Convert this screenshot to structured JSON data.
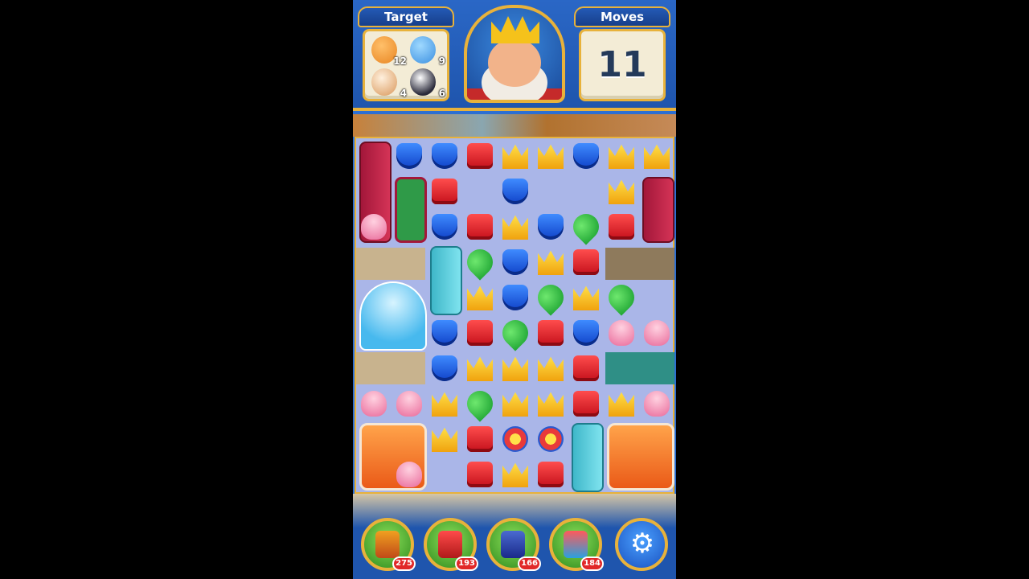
{
  "hud": {
    "target_title": "Target",
    "moves_title": "Moves",
    "moves_value": "11",
    "targets": [
      {
        "icon": "teddy-bear-icon",
        "count": "12"
      },
      {
        "icon": "blue-balloon-icon",
        "count": "9"
      },
      {
        "icon": "hamster-icon",
        "count": "4"
      },
      {
        "icon": "penguin-icon",
        "count": "6"
      }
    ]
  },
  "boosters": [
    {
      "icon": "hammer-icon",
      "count": "275"
    },
    {
      "icon": "arrow-icon",
      "count": "193"
    },
    {
      "icon": "cannon-icon",
      "count": "166"
    },
    {
      "icon": "jester-icon",
      "count": "184"
    }
  ],
  "settings_icon": "gear-icon",
  "settings_glyph": "⚙",
  "board": {
    "columns": 9,
    "rows": 10,
    "gems": [
      [
        1,
        0,
        "blue"
      ],
      [
        2,
        0,
        "blue"
      ],
      [
        3,
        0,
        "red"
      ],
      [
        4,
        0,
        "yellow"
      ],
      [
        5,
        0,
        "yellow"
      ],
      [
        6,
        0,
        "blue"
      ],
      [
        7,
        0,
        "yellow"
      ],
      [
        8,
        0,
        "yellow"
      ],
      [
        2,
        1,
        "red"
      ],
      [
        4,
        1,
        "blue"
      ],
      [
        7,
        1,
        "yellow"
      ],
      [
        0,
        2,
        "shell"
      ],
      [
        2,
        2,
        "blue"
      ],
      [
        3,
        2,
        "red"
      ],
      [
        4,
        2,
        "yellow"
      ],
      [
        5,
        2,
        "blue"
      ],
      [
        6,
        2,
        "green"
      ],
      [
        7,
        2,
        "red"
      ],
      [
        3,
        3,
        "green"
      ],
      [
        4,
        3,
        "blue"
      ],
      [
        5,
        3,
        "yellow"
      ],
      [
        6,
        3,
        "red"
      ],
      [
        3,
        4,
        "yellow"
      ],
      [
        4,
        4,
        "blue"
      ],
      [
        5,
        4,
        "green"
      ],
      [
        6,
        4,
        "yellow"
      ],
      [
        7,
        4,
        "green"
      ],
      [
        2,
        5,
        "blue"
      ],
      [
        3,
        5,
        "red"
      ],
      [
        4,
        5,
        "green"
      ],
      [
        5,
        5,
        "red"
      ],
      [
        6,
        5,
        "blue"
      ],
      [
        7,
        5,
        "shell"
      ],
      [
        8,
        5,
        "shell"
      ],
      [
        2,
        6,
        "blue"
      ],
      [
        3,
        6,
        "yellow"
      ],
      [
        4,
        6,
        "yellow"
      ],
      [
        5,
        6,
        "yellow"
      ],
      [
        6,
        6,
        "red"
      ],
      [
        0,
        7,
        "shell"
      ],
      [
        1,
        7,
        "shell"
      ],
      [
        2,
        7,
        "yellow"
      ],
      [
        3,
        7,
        "green"
      ],
      [
        4,
        7,
        "yellow"
      ],
      [
        5,
        7,
        "yellow"
      ],
      [
        6,
        7,
        "red"
      ],
      [
        7,
        7,
        "yellow"
      ],
      [
        8,
        7,
        "shell"
      ],
      [
        2,
        8,
        "yellow"
      ],
      [
        3,
        8,
        "red"
      ],
      [
        4,
        8,
        "bomb"
      ],
      [
        5,
        8,
        "bomb"
      ],
      [
        1,
        9,
        "shell"
      ],
      [
        3,
        9,
        "red"
      ],
      [
        4,
        9,
        "yellow"
      ],
      [
        5,
        9,
        "red"
      ]
    ]
  },
  "colors": {
    "accent_gold": "#e8b23b",
    "hud_blue": "#2a67c6",
    "board_bg": "#aab6e8"
  }
}
